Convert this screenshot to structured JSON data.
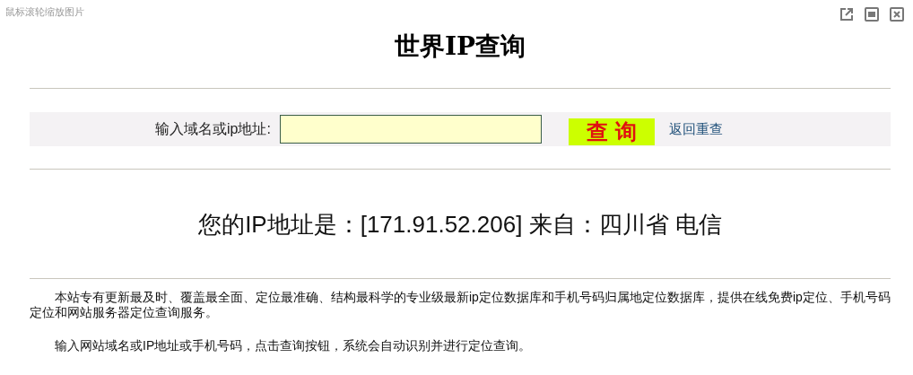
{
  "viewer": {
    "hint": "鼠标滚轮缩放图片"
  },
  "title": "世界IP查询",
  "search": {
    "label": "输入域名或ip地址:",
    "button": "查 询",
    "link": "返回重查"
  },
  "result": {
    "ip_label": "您的IP地址是：",
    "ip": "[171.91.52.206]",
    "from_label": "来自：",
    "location": "四川省  电信"
  },
  "paragraphs": [
    "本站专有更新最及时、覆盖最全面、定位最准确、结构最科学的专业级最新ip定位数据库和手机号码归属地定位数据库，提供在线免费ip定位、手机号码定位和网站服务器定位查询服务。",
    "输入网站域名或IP地址或手机号码，点击查询按钮，系统会自动识别并进行定位查询。"
  ]
}
